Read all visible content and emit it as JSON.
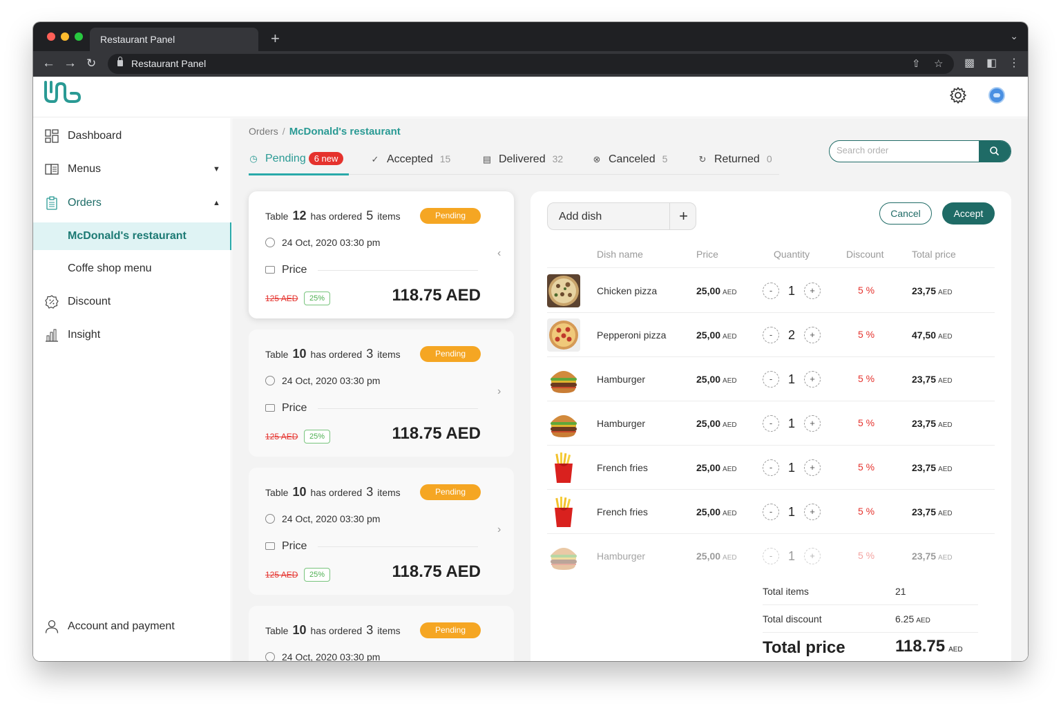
{
  "browser": {
    "tab_title": "Restaurant Panel",
    "address": "Restaurant Panel"
  },
  "brand": {
    "accent": "#1f6b66",
    "teal": "#2a9a94",
    "pending": "#f5a623",
    "alert": "#e5322d"
  },
  "header": {
    "settings_icon": "gear-icon",
    "avatar_icon": "user-avatar"
  },
  "sidebar": {
    "items": [
      {
        "label": "Dashboard",
        "icon": "dashboard-icon"
      },
      {
        "label": "Menus",
        "icon": "menu-book-icon"
      },
      {
        "label": "Orders",
        "icon": "clipboard-icon"
      },
      {
        "label": "Discount",
        "icon": "discount-badge-icon"
      },
      {
        "label": "Insight",
        "icon": "bar-chart-icon"
      }
    ],
    "sub_items": [
      {
        "label": "McDonald's restaurant"
      },
      {
        "label": "Coffe shop menu"
      }
    ],
    "account": {
      "label": "Account and payment",
      "icon": "user-icon"
    }
  },
  "breadcrumb": {
    "root": "Orders",
    "separator": "/",
    "current": "McDonald's restaurant"
  },
  "status_tabs": [
    {
      "label": "Pending",
      "badge": "6 new",
      "icon": "clock-icon"
    },
    {
      "label": "Accepted",
      "count": "15",
      "icon": "check-circle-icon"
    },
    {
      "label": "Delivered",
      "count": "32",
      "icon": "receipt-icon"
    },
    {
      "label": "Canceled",
      "count": "5",
      "icon": "x-circle-icon"
    },
    {
      "label": "Returned",
      "count": "0",
      "icon": "refresh-icon"
    }
  ],
  "search": {
    "placeholder": "Search order",
    "value": ""
  },
  "order_cards": [
    {
      "table_prefix": "Table",
      "table": "12",
      "ordered_text": "has ordered",
      "items": "5",
      "items_text": "items",
      "status": "Pending",
      "date": "24 Oct, 2020 03:30 pm",
      "price_label": "Price",
      "old_price": "125 AED",
      "discount": "25%",
      "total": "118.75 AED"
    },
    {
      "table_prefix": "Table",
      "table": "10",
      "ordered_text": "has ordered",
      "items": "3",
      "items_text": "items",
      "status": "Pending",
      "date": "24 Oct, 2020 03:30 pm",
      "price_label": "Price",
      "old_price": "125 AED",
      "discount": "25%",
      "total": "118.75 AED"
    },
    {
      "table_prefix": "Table",
      "table": "10",
      "ordered_text": "has ordered",
      "items": "3",
      "items_text": "items",
      "status": "Pending",
      "date": "24 Oct, 2020 03:30 pm",
      "price_label": "Price",
      "old_price": "125 AED",
      "discount": "25%",
      "total": "118.75 AED"
    },
    {
      "table_prefix": "Table",
      "table": "10",
      "ordered_text": "has ordered",
      "items": "3",
      "items_text": "items",
      "status": "Pending",
      "date": "24 Oct, 2020 03:30 pm"
    }
  ],
  "detail": {
    "add_dish": "Add dish",
    "cancel": "Cancel",
    "accept": "Accept",
    "columns": [
      "Dish name",
      "Price",
      "Quantity",
      "Discount",
      "Total price"
    ],
    "currency": "AED",
    "dishes": [
      {
        "name": "Chicken pizza",
        "price": "25,00",
        "qty": "1",
        "discount": "5 %",
        "total": "23,75",
        "image": "chicken-pizza"
      },
      {
        "name": "Pepperoni pizza",
        "price": "25,00",
        "qty": "2",
        "discount": "5 %",
        "total": "47,50",
        "image": "pepperoni-pizza"
      },
      {
        "name": "Hamburger",
        "price": "25,00",
        "qty": "1",
        "discount": "5 %",
        "total": "23,75",
        "image": "hamburger"
      },
      {
        "name": "Hamburger",
        "price": "25,00",
        "qty": "1",
        "discount": "5 %",
        "total": "23,75",
        "image": "hamburger"
      },
      {
        "name": "French fries",
        "price": "25,00",
        "qty": "1",
        "discount": "5 %",
        "total": "23,75",
        "image": "french-fries"
      },
      {
        "name": "French fries",
        "price": "25,00",
        "qty": "1",
        "discount": "5 %",
        "total": "23,75",
        "image": "french-fries"
      },
      {
        "name": "Hamburger",
        "price": "25,00",
        "qty": "1",
        "discount": "5 %",
        "total": "23,75",
        "image": "hamburger"
      }
    ],
    "summary": {
      "total_items_label": "Total items",
      "total_items": "21",
      "total_discount_label": "Total discount",
      "total_discount": "6.25",
      "total_price_label": "Total price",
      "total_price": "118.75"
    }
  }
}
